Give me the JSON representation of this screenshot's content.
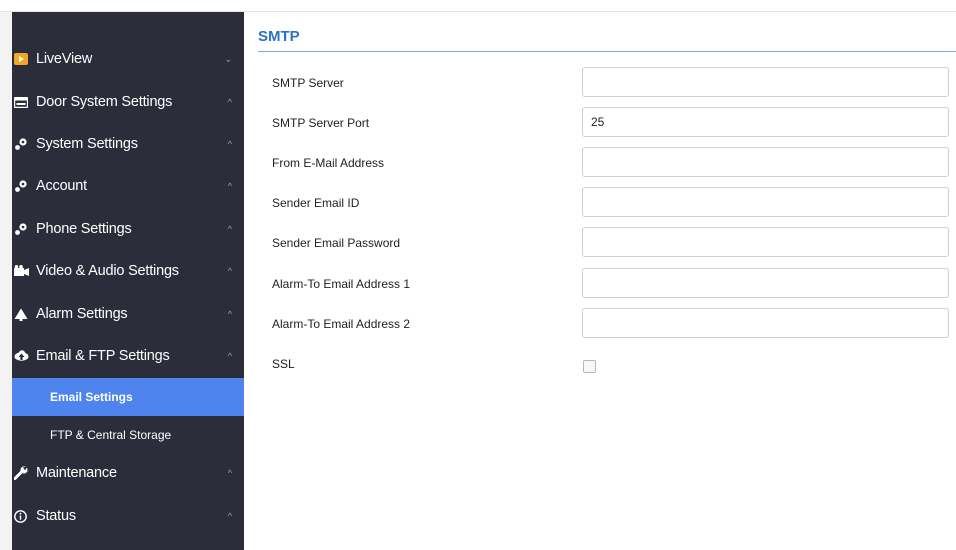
{
  "sidebar": {
    "items": [
      {
        "label": "LiveView",
        "icon": "play-icon",
        "chevron": "⌄"
      },
      {
        "label": "Door System Settings",
        "icon": "panel-icon",
        "chevron": "^"
      },
      {
        "label": "System Settings",
        "icon": "wrench-gear-icon",
        "chevron": "^"
      },
      {
        "label": "Account",
        "icon": "wrench-gear-icon",
        "chevron": "^"
      },
      {
        "label": "Phone Settings",
        "icon": "wrench-gear-icon",
        "chevron": "^"
      },
      {
        "label": "Video & Audio Settings",
        "icon": "video-icon",
        "chevron": "^"
      },
      {
        "label": "Alarm Settings",
        "icon": "bell-icon",
        "chevron": "^"
      },
      {
        "label": "Email & FTP Settings",
        "icon": "cloud-upload-icon",
        "chevron": "^"
      },
      {
        "label": "Maintenance",
        "icon": "wrench-icon",
        "chevron": "^"
      },
      {
        "label": "Status",
        "icon": "info-icon",
        "chevron": "^"
      }
    ],
    "subitems": [
      {
        "label": "Email Settings",
        "active": true
      },
      {
        "label": "FTP & Central Storage",
        "active": false
      }
    ]
  },
  "main": {
    "section_title": "SMTP",
    "fields": [
      {
        "label": "SMTP Server",
        "value": ""
      },
      {
        "label": "SMTP Server Port",
        "value": "25"
      },
      {
        "label": "From E-Mail Address",
        "value": ""
      },
      {
        "label": "Sender Email ID",
        "value": ""
      },
      {
        "label": "Sender Email Password",
        "value": ""
      },
      {
        "label": "Alarm-To Email Address 1",
        "value": ""
      },
      {
        "label": "Alarm-To Email Address 2",
        "value": ""
      }
    ],
    "ssl": {
      "label": "SSL",
      "checked": false
    }
  },
  "colors": {
    "sidebar_bg": "#2b2d3a",
    "active_bg": "#4f84ef",
    "title_blue": "#2a73c9",
    "liveview_orange": "#f5a623"
  }
}
